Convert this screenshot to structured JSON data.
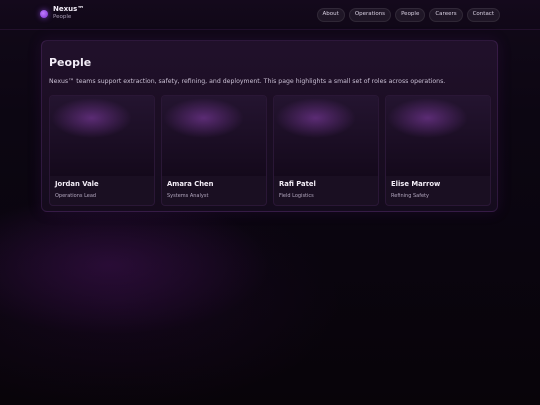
{
  "brand": {
    "name": "Nexus™",
    "subtitle": "People",
    "accent": "#a05cff"
  },
  "nav": {
    "items": [
      {
        "label": "About"
      },
      {
        "label": "Operations"
      },
      {
        "label": "People"
      },
      {
        "label": "Careers"
      },
      {
        "label": "Contact"
      }
    ]
  },
  "main": {
    "title": "People",
    "description": "Nexus™ teams support extraction, safety, refining, and deployment. This page highlights a small set of roles across operations.",
    "people": [
      {
        "name": "Jordan Vale",
        "role": "Operations Lead"
      },
      {
        "name": "Amara Chen",
        "role": "Systems Analyst"
      },
      {
        "name": "Rafi Patel",
        "role": "Field Logistics"
      },
      {
        "name": "Elise Marrow",
        "role": "Refining Safety"
      }
    ]
  }
}
